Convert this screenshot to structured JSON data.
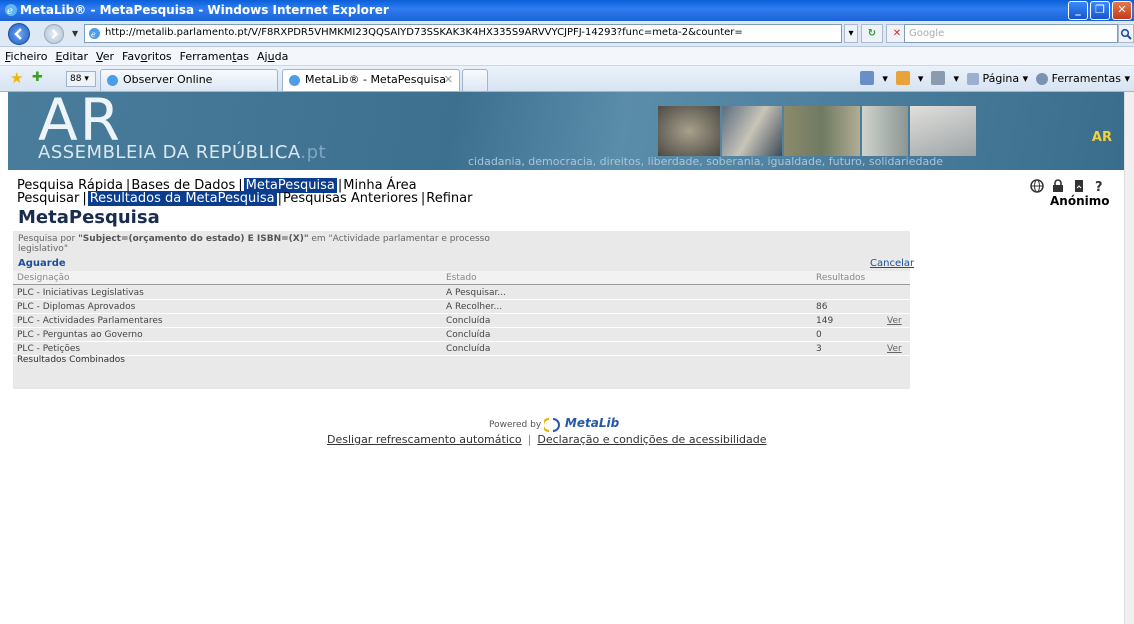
{
  "window": {
    "title": "MetaLib® - MetaPesquisa - Windows Internet Explorer",
    "buttons": [
      "_",
      "❐",
      "✕"
    ]
  },
  "address": {
    "url": "http://metalib.parlamento.pt/V/F8RXPDR5VHMKMI23QQSAIYD73SSKAK3K4HX335S9ARVVYCJPFJ-14293?func=meta-2&counter=",
    "search_placeholder": "Google"
  },
  "menu": [
    {
      "pre": "",
      "u": "F",
      "post": "icheiro"
    },
    {
      "pre": "",
      "u": "E",
      "post": "ditar"
    },
    {
      "pre": "",
      "u": "V",
      "post": "er"
    },
    {
      "pre": "Fav",
      "u": "o",
      "post": "ritos"
    },
    {
      "pre": "Ferramen",
      "u": "t",
      "post": "as"
    },
    {
      "pre": "Aj",
      "u": "u",
      "post": "da"
    }
  ],
  "tabs": {
    "quick_tabs": "88",
    "items": [
      "Observer Online",
      "MetaLib® - MetaPesquisa"
    ],
    "close": "✕"
  },
  "command_bar": {
    "page": "Página",
    "tools": "Ferramentas"
  },
  "banner": {
    "logo_big": "AR",
    "logo_name": "ASSEMBLEIA DA REPÚBLICA",
    "logo_tld": ".pt",
    "motto": "cidadania, democracia, direitos, liberdade, soberania, igualdade, futuro, solidariedade",
    "badge": "AR"
  },
  "nav": {
    "row1": [
      "Pesquisa Rápida",
      "Bases de Dados",
      "MetaPesquisa",
      "Minha Área"
    ],
    "row2": [
      "Pesquisar",
      "Resultados da MetaPesquisa",
      "Pesquisas Anteriores",
      "Refinar"
    ]
  },
  "user": "Anónimo",
  "page_title": "MetaPesquisa",
  "results": {
    "query_prefix": "Pesquisa por ",
    "query_main": "\"Subject=(orçamento do estado) E ISBN=(X)\"",
    "query_suffix": " em \"Actividade parlamentar e processo legislativo\"",
    "wait": "Aguarde",
    "cancel": "Cancelar",
    "headers": {
      "name": "Designação",
      "status": "Estado",
      "results": "Resultados"
    },
    "rows": [
      {
        "name": "PLC - Iniciativas Legislativas",
        "status": "A Pesquisar...",
        "count": "",
        "view": ""
      },
      {
        "name": "PLC - Diplomas Aprovados",
        "status": "A Recolher...",
        "count": "86",
        "view": ""
      },
      {
        "name": "PLC - Actividades Parlamentares",
        "status": "Concluída",
        "count": "149",
        "view": "Ver"
      },
      {
        "name": "PLC - Perguntas ao Governo",
        "status": "Concluída",
        "count": "0",
        "view": ""
      },
      {
        "name": "PLC - Petições",
        "status": "Concluída",
        "count": "3",
        "view": "Ver"
      }
    ],
    "combined": "Resultados Combinados"
  },
  "footer": {
    "powered_by": "Powered by",
    "brand": "MetaLib",
    "link1": "Desligar refrescamento automático",
    "separator": "|",
    "link2": "Declaração e condições de acessibilidade"
  },
  "colors": {
    "titlebar": "#1b62d6",
    "banner": "#3d6f8f",
    "nav_selected": "#0a3d8e",
    "badge": "#f2d13a",
    "link": "#1e4f9a"
  }
}
